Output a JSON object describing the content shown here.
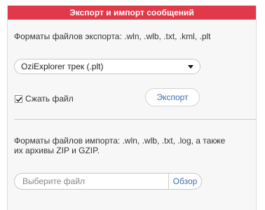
{
  "header": {
    "title": "Экспорт и импорт сообщений",
    "background_color": "#e0394a"
  },
  "export": {
    "formats_text": "Форматы файлов экспорта: .wln, .wlb, .txt, .kml, .plt",
    "format_select": {
      "selected": "OziExplorer трек (.plt)"
    },
    "compress": {
      "label": "Сжать файл",
      "checked": true
    },
    "export_button_label": "Экспорт"
  },
  "import": {
    "formats_text_line1": "Форматы файлов импорта: .wln, .wlb, .txt, .log, а также",
    "formats_text_line2": "их архивы ZIP и GZIP.",
    "file_input": {
      "placeholder": "Выберите файл",
      "browse_label": "Обзор"
    }
  },
  "link_color": "#3b6fb0"
}
